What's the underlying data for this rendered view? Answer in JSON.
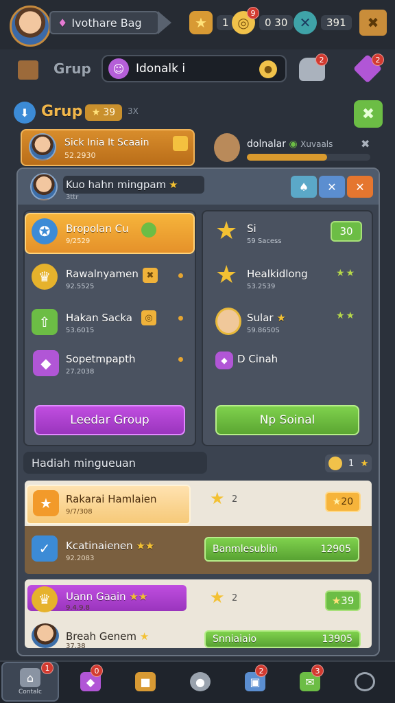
{
  "top_bar": {
    "player_name": "Ivothare Bag",
    "currency_1": "1",
    "currency_2": "0 30",
    "currency_3": "391",
    "badge_coin": "9"
  },
  "row2": {
    "grup_label": "Grup",
    "search_value": "Idonalk i",
    "badge_hat": "2",
    "badge_gem": "2"
  },
  "row3": {
    "title": "Grup",
    "level_chip": "39",
    "level_extra": "3X"
  },
  "header_cards": {
    "card1_title": "Sick Inia It Scaain",
    "card1_sub": "52.2930",
    "card2_title": "dolnalar",
    "card2_sub": "Xuvaals",
    "card2_progress": 0.65
  },
  "panel": {
    "header_name": "Kuo hahn mingpam",
    "header_sub": "3ttr",
    "left_items": [
      {
        "title": "Bropolan Cu",
        "sub": "9/2529"
      },
      {
        "title": "Rawalnyamen",
        "sub": "92.5525"
      },
      {
        "title": "Hakan Sacka",
        "sub": "53.6015"
      },
      {
        "title": "Sopetmpapth",
        "sub": "27.2038"
      }
    ],
    "right_items": [
      {
        "title": "Si",
        "sub": "59 Sacess",
        "value": "30"
      },
      {
        "title": "Healkidlong",
        "sub": "53.2539"
      },
      {
        "title": "Sular",
        "sub": "59.8650S"
      },
      {
        "title": "D Cinah"
      }
    ],
    "button_left": "Leedar Group",
    "button_right": "Np Soinal"
  },
  "weekly": {
    "title": "Hadiah mingueuan",
    "count": "1",
    "rows": [
      {
        "title": "Rakarai Hamlaien",
        "sub": "9/7/308",
        "star_count": "2",
        "value": "20"
      },
      {
        "title": "Kcatinaienen",
        "sub": "92.2083",
        "bar_label": "Banmlesublin",
        "bar_value": "12905"
      },
      {
        "title": "Uann Gaain",
        "sub": "9.4.9.8",
        "star_count": "2",
        "value": "39"
      },
      {
        "title": "Breah Genem",
        "sub": "37.38",
        "bar_label": "Snniaiaio",
        "bar_value": "13905"
      }
    ]
  },
  "bottom_nav": {
    "items": [
      {
        "label": "Contalc",
        "badge": "1"
      },
      {
        "label": "",
        "badge": "0"
      },
      {
        "label": "",
        "badge": ""
      },
      {
        "label": "",
        "badge": ""
      },
      {
        "label": "",
        "badge": "2"
      },
      {
        "label": "",
        "badge": "3"
      },
      {
        "label": "",
        "badge": ""
      }
    ]
  }
}
